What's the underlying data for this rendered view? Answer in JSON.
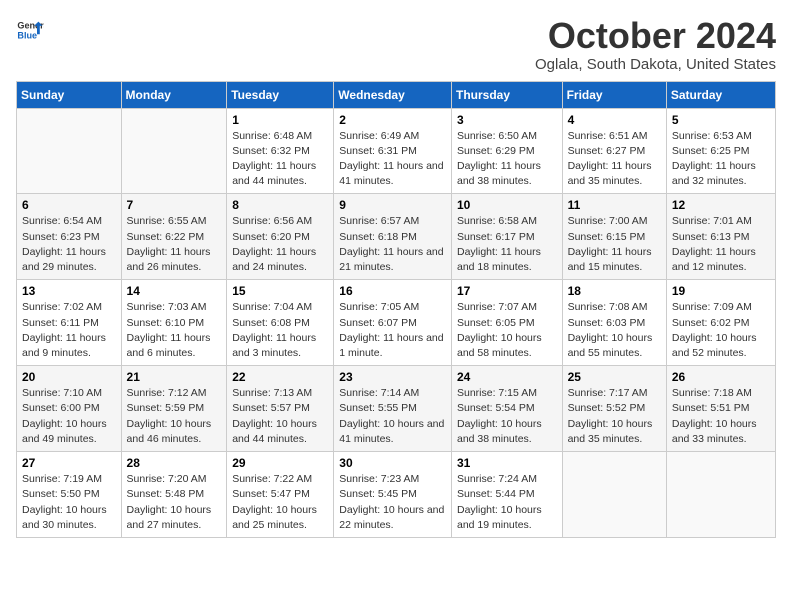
{
  "header": {
    "logo_general": "General",
    "logo_blue": "Blue",
    "month_title": "October 2024",
    "location": "Oglala, South Dakota, United States"
  },
  "days_of_week": [
    "Sunday",
    "Monday",
    "Tuesday",
    "Wednesday",
    "Thursday",
    "Friday",
    "Saturday"
  ],
  "weeks": [
    [
      {
        "day": "",
        "info": ""
      },
      {
        "day": "",
        "info": ""
      },
      {
        "day": "1",
        "info": "Sunrise: 6:48 AM\nSunset: 6:32 PM\nDaylight: 11 hours and 44 minutes."
      },
      {
        "day": "2",
        "info": "Sunrise: 6:49 AM\nSunset: 6:31 PM\nDaylight: 11 hours and 41 minutes."
      },
      {
        "day": "3",
        "info": "Sunrise: 6:50 AM\nSunset: 6:29 PM\nDaylight: 11 hours and 38 minutes."
      },
      {
        "day": "4",
        "info": "Sunrise: 6:51 AM\nSunset: 6:27 PM\nDaylight: 11 hours and 35 minutes."
      },
      {
        "day": "5",
        "info": "Sunrise: 6:53 AM\nSunset: 6:25 PM\nDaylight: 11 hours and 32 minutes."
      }
    ],
    [
      {
        "day": "6",
        "info": "Sunrise: 6:54 AM\nSunset: 6:23 PM\nDaylight: 11 hours and 29 minutes."
      },
      {
        "day": "7",
        "info": "Sunrise: 6:55 AM\nSunset: 6:22 PM\nDaylight: 11 hours and 26 minutes."
      },
      {
        "day": "8",
        "info": "Sunrise: 6:56 AM\nSunset: 6:20 PM\nDaylight: 11 hours and 24 minutes."
      },
      {
        "day": "9",
        "info": "Sunrise: 6:57 AM\nSunset: 6:18 PM\nDaylight: 11 hours and 21 minutes."
      },
      {
        "day": "10",
        "info": "Sunrise: 6:58 AM\nSunset: 6:17 PM\nDaylight: 11 hours and 18 minutes."
      },
      {
        "day": "11",
        "info": "Sunrise: 7:00 AM\nSunset: 6:15 PM\nDaylight: 11 hours and 15 minutes."
      },
      {
        "day": "12",
        "info": "Sunrise: 7:01 AM\nSunset: 6:13 PM\nDaylight: 11 hours and 12 minutes."
      }
    ],
    [
      {
        "day": "13",
        "info": "Sunrise: 7:02 AM\nSunset: 6:11 PM\nDaylight: 11 hours and 9 minutes."
      },
      {
        "day": "14",
        "info": "Sunrise: 7:03 AM\nSunset: 6:10 PM\nDaylight: 11 hours and 6 minutes."
      },
      {
        "day": "15",
        "info": "Sunrise: 7:04 AM\nSunset: 6:08 PM\nDaylight: 11 hours and 3 minutes."
      },
      {
        "day": "16",
        "info": "Sunrise: 7:05 AM\nSunset: 6:07 PM\nDaylight: 11 hours and 1 minute."
      },
      {
        "day": "17",
        "info": "Sunrise: 7:07 AM\nSunset: 6:05 PM\nDaylight: 10 hours and 58 minutes."
      },
      {
        "day": "18",
        "info": "Sunrise: 7:08 AM\nSunset: 6:03 PM\nDaylight: 10 hours and 55 minutes."
      },
      {
        "day": "19",
        "info": "Sunrise: 7:09 AM\nSunset: 6:02 PM\nDaylight: 10 hours and 52 minutes."
      }
    ],
    [
      {
        "day": "20",
        "info": "Sunrise: 7:10 AM\nSunset: 6:00 PM\nDaylight: 10 hours and 49 minutes."
      },
      {
        "day": "21",
        "info": "Sunrise: 7:12 AM\nSunset: 5:59 PM\nDaylight: 10 hours and 46 minutes."
      },
      {
        "day": "22",
        "info": "Sunrise: 7:13 AM\nSunset: 5:57 PM\nDaylight: 10 hours and 44 minutes."
      },
      {
        "day": "23",
        "info": "Sunrise: 7:14 AM\nSunset: 5:55 PM\nDaylight: 10 hours and 41 minutes."
      },
      {
        "day": "24",
        "info": "Sunrise: 7:15 AM\nSunset: 5:54 PM\nDaylight: 10 hours and 38 minutes."
      },
      {
        "day": "25",
        "info": "Sunrise: 7:17 AM\nSunset: 5:52 PM\nDaylight: 10 hours and 35 minutes."
      },
      {
        "day": "26",
        "info": "Sunrise: 7:18 AM\nSunset: 5:51 PM\nDaylight: 10 hours and 33 minutes."
      }
    ],
    [
      {
        "day": "27",
        "info": "Sunrise: 7:19 AM\nSunset: 5:50 PM\nDaylight: 10 hours and 30 minutes."
      },
      {
        "day": "28",
        "info": "Sunrise: 7:20 AM\nSunset: 5:48 PM\nDaylight: 10 hours and 27 minutes."
      },
      {
        "day": "29",
        "info": "Sunrise: 7:22 AM\nSunset: 5:47 PM\nDaylight: 10 hours and 25 minutes."
      },
      {
        "day": "30",
        "info": "Sunrise: 7:23 AM\nSunset: 5:45 PM\nDaylight: 10 hours and 22 minutes."
      },
      {
        "day": "31",
        "info": "Sunrise: 7:24 AM\nSunset: 5:44 PM\nDaylight: 10 hours and 19 minutes."
      },
      {
        "day": "",
        "info": ""
      },
      {
        "day": "",
        "info": ""
      }
    ]
  ]
}
